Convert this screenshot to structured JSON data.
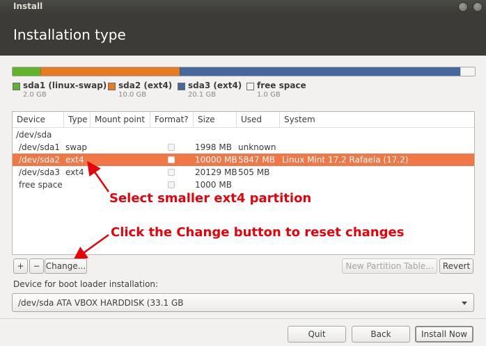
{
  "window": {
    "title": "Install"
  },
  "header": {
    "title": "Installation type"
  },
  "partition_bar": [
    {
      "name": "sda1 (linux-swap)",
      "size": "2.0 GB",
      "fraction": 0.06,
      "color": "#62b32b"
    },
    {
      "name": "sda2 (ext4)",
      "size": "10.0 GB",
      "fraction": 0.302,
      "color": "#e87a21"
    },
    {
      "name": "sda3 (ext4)",
      "size": "20.1 GB",
      "fraction": 0.608,
      "color": "#46689c"
    },
    {
      "name": "free space",
      "size": "1.0 GB",
      "fraction": 0.03,
      "color": "#f4f4f4"
    }
  ],
  "table": {
    "columns": [
      "Device",
      "Type",
      "Mount point",
      "Format?",
      "Size",
      "Used",
      "System"
    ],
    "rows": [
      {
        "device": "/dev/sda",
        "type": "",
        "mount": "",
        "format": false,
        "size": "",
        "used": "",
        "system": "",
        "selected": false,
        "indent": false,
        "has_checkbox": false
      },
      {
        "device": "/dev/sda1",
        "type": "swap",
        "mount": "",
        "format": false,
        "size": "1998 MB",
        "used": "unknown",
        "system": "",
        "selected": false,
        "indent": true,
        "has_checkbox": true
      },
      {
        "device": "/dev/sda2",
        "type": "ext4",
        "mount": "",
        "format": false,
        "size": "10000 MB",
        "used": "5847 MB",
        "system": "Linux Mint 17.2 Rafaela (17.2)",
        "selected": true,
        "indent": true,
        "has_checkbox": true
      },
      {
        "device": "/dev/sda3",
        "type": "ext4",
        "mount": "",
        "format": false,
        "size": "20129 MB",
        "used": "505 MB",
        "system": "",
        "selected": false,
        "indent": true,
        "has_checkbox": true
      },
      {
        "device": "free space",
        "type": "",
        "mount": "",
        "format": false,
        "size": "1000 MB",
        "used": "",
        "system": "",
        "selected": false,
        "indent": true,
        "has_checkbox": true
      }
    ]
  },
  "annotations": {
    "select_text": "Select smaller ext4 partition",
    "change_text": "Click the Change button to reset changes",
    "color": "#e8000a"
  },
  "toolbar": {
    "add_icon": "plus-icon",
    "add_label": "+",
    "remove_icon": "minus-icon",
    "remove_label": "−",
    "change_label": "Change...",
    "new_table_label": "New Partition Table...",
    "revert_label": "Revert"
  },
  "bootloader": {
    "label": "Device for boot loader installation:",
    "selected": "/dev/sda   ATA VBOX HARDDISK (33.1 GB"
  },
  "footer": {
    "quit_label": "Quit",
    "back_label": "Back",
    "install_label": "Install Now"
  }
}
